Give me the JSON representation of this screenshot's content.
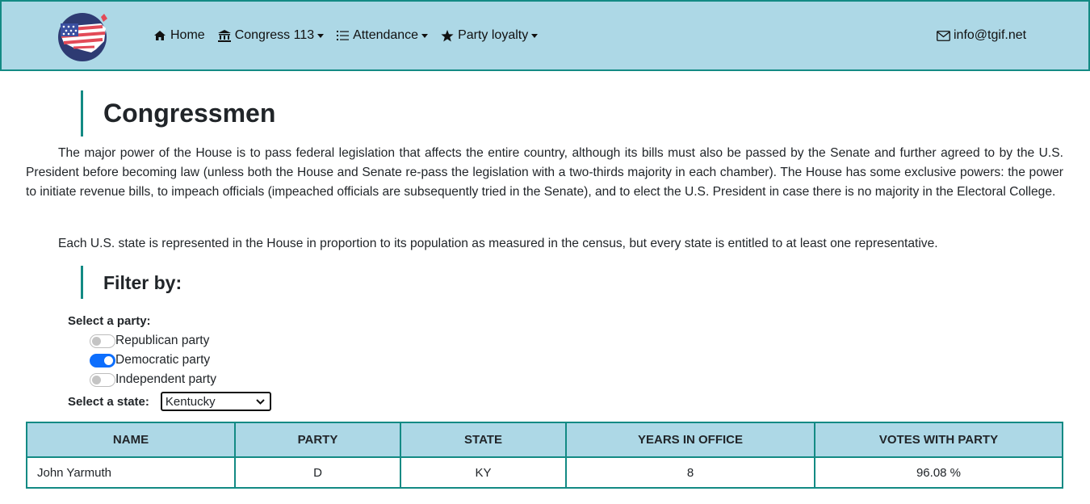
{
  "nav": {
    "items": [
      {
        "label": "Home",
        "icon": "home-icon"
      },
      {
        "label": "Congress 113",
        "icon": "bank-icon"
      },
      {
        "label": "Attendance",
        "icon": "list-icon"
      },
      {
        "label": "Party loyalty",
        "icon": "star-icon"
      }
    ],
    "contact": "info@tgif.net"
  },
  "page": {
    "title": "Congressmen",
    "intro": "The major power of the House is to pass federal legislation that affects the entire country, although its bills must also be passed by the Senate and further agreed to by the U.S. President before becoming law (unless both the House and Senate re-pass the legislation with a two-thirds majority in each chamber). The House has some exclusive powers: the power to initiate revenue bills, to impeach officials (impeached officials are subsequently tried in the Senate), and to elect the U.S. President in case there is no majority in the Electoral College.",
    "intro2": "Each U.S. state is represented in the House in proportion to its population as measured in the census, but every state is entitled to at least one representative."
  },
  "filter": {
    "heading": "Filter by:",
    "party_label": "Select a party:",
    "parties": [
      {
        "label": "Republican party",
        "checked": false
      },
      {
        "label": "Democratic party",
        "checked": true
      },
      {
        "label": "Independent party",
        "checked": false
      }
    ],
    "state_label": "Select a state:",
    "state_selected": "Kentucky"
  },
  "table": {
    "headers": [
      "NAME",
      "PARTY",
      "STATE",
      "YEARS IN OFFICE",
      "VOTES WITH PARTY"
    ],
    "rows": [
      [
        "John Yarmuth",
        "D",
        "KY",
        "8",
        "96.08 %"
      ]
    ]
  },
  "colors": {
    "accent": "#138a84",
    "header_bg": "#add8e6",
    "switch_on": "#0d6efd"
  }
}
